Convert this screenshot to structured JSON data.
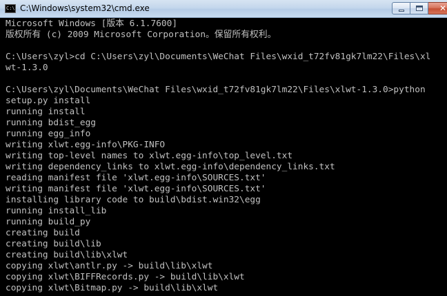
{
  "window": {
    "title": "C:\\Windows\\system32\\cmd.exe",
    "icon_name": "console-app-icon",
    "icon_text": "C:\\"
  },
  "caption_buttons": {
    "minimize_icon": "minimize-icon",
    "maximize_icon": "maximize-icon",
    "close_icon": "close-icon",
    "close_glyph": "✕"
  },
  "colors": {
    "console_background": "#000000",
    "console_text": "#c0c0c0",
    "titlebar": "#c4d7ec",
    "close_button": "#c44f34"
  },
  "console": {
    "lines": [
      "Microsoft Windows [版本 6.1.7600]",
      "版权所有 (c) 2009 Microsoft Corporation。保留所有权利。",
      "",
      "C:\\Users\\zyl>cd C:\\Users\\zyl\\Documents\\WeChat Files\\wxid_t72fv81gk7lm22\\Files\\xl",
      "wt-1.3.0",
      "",
      "C:\\Users\\zyl\\Documents\\WeChat Files\\wxid_t72fv81gk7lm22\\Files\\xlwt-1.3.0>python",
      "setup.py install",
      "running install",
      "running bdist_egg",
      "running egg_info",
      "writing xlwt.egg-info\\PKG-INFO",
      "writing top-level names to xlwt.egg-info\\top_level.txt",
      "writing dependency_links to xlwt.egg-info\\dependency_links.txt",
      "reading manifest file 'xlwt.egg-info\\SOURCES.txt'",
      "writing manifest file 'xlwt.egg-info\\SOURCES.txt'",
      "installing library code to build\\bdist.win32\\egg",
      "running install_lib",
      "running build_py",
      "creating build",
      "creating build\\lib",
      "creating build\\lib\\xlwt",
      "copying xlwt\\antlr.py -> build\\lib\\xlwt",
      "copying xlwt\\BIFFRecords.py -> build\\lib\\xlwt",
      "copying xlwt\\Bitmap.py -> build\\lib\\xlwt"
    ]
  }
}
